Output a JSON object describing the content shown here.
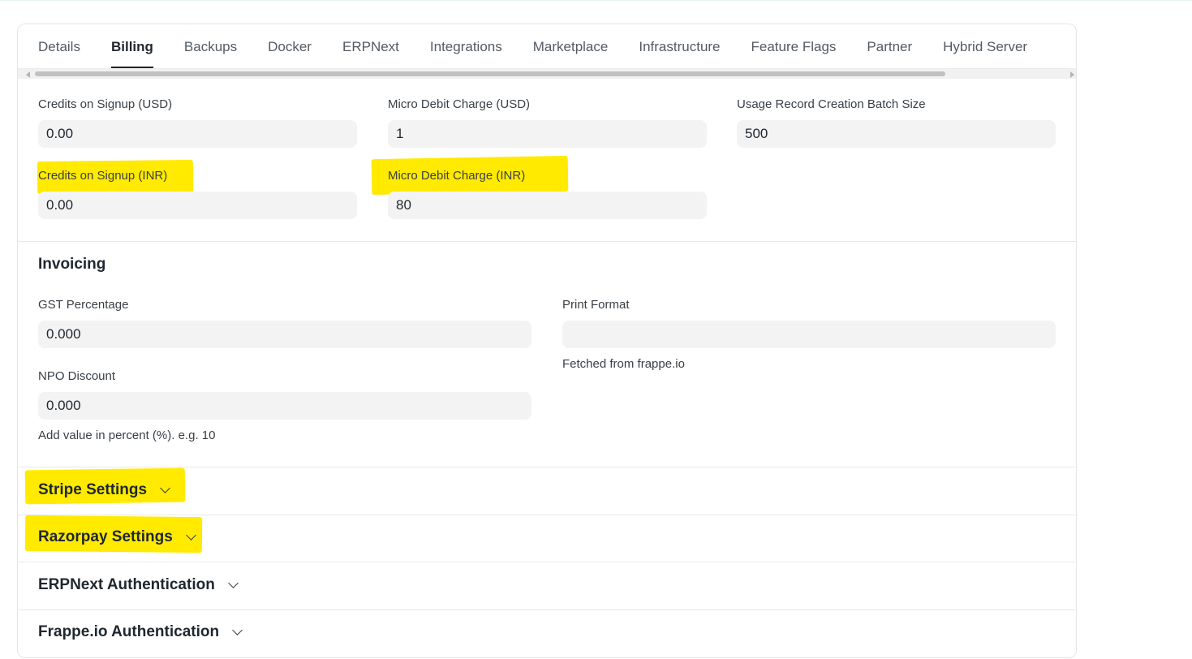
{
  "tabs": [
    {
      "label": "Details",
      "active": false
    },
    {
      "label": "Billing",
      "active": true
    },
    {
      "label": "Backups",
      "active": false
    },
    {
      "label": "Docker",
      "active": false
    },
    {
      "label": "ERPNext",
      "active": false
    },
    {
      "label": "Integrations",
      "active": false
    },
    {
      "label": "Marketplace",
      "active": false
    },
    {
      "label": "Infrastructure",
      "active": false
    },
    {
      "label": "Feature Flags",
      "active": false
    },
    {
      "label": "Partner",
      "active": false
    },
    {
      "label": "Hybrid Server",
      "active": false
    }
  ],
  "credits": {
    "signup_usd_label": "Credits on Signup (USD)",
    "signup_usd_value": "0.00",
    "micro_usd_label": "Micro Debit Charge (USD)",
    "micro_usd_value": "1",
    "batch_label": "Usage Record Creation Batch Size",
    "batch_value": "500",
    "signup_inr_label": "Credits on Signup (INR)",
    "signup_inr_value": "0.00",
    "micro_inr_label": "Micro Debit Charge (INR)",
    "micro_inr_value": "80"
  },
  "invoicing": {
    "title": "Invoicing",
    "gst_label": "GST Percentage",
    "gst_value": "0.000",
    "print_label": "Print Format",
    "print_value": "",
    "print_desc": "Fetched from frappe.io",
    "npo_label": "NPO Discount",
    "npo_value": "0.000",
    "npo_desc": "Add value in percent (%). e.g. 10"
  },
  "sections": {
    "stripe": "Stripe Settings",
    "razorpay": "Razorpay Settings",
    "erpnext_auth": "ERPNext Authentication",
    "frappe_auth": "Frappe.io Authentication"
  },
  "colors": {
    "highlight": "#ffea00",
    "text": "#1f272e",
    "input_bg": "#f3f3f3"
  }
}
